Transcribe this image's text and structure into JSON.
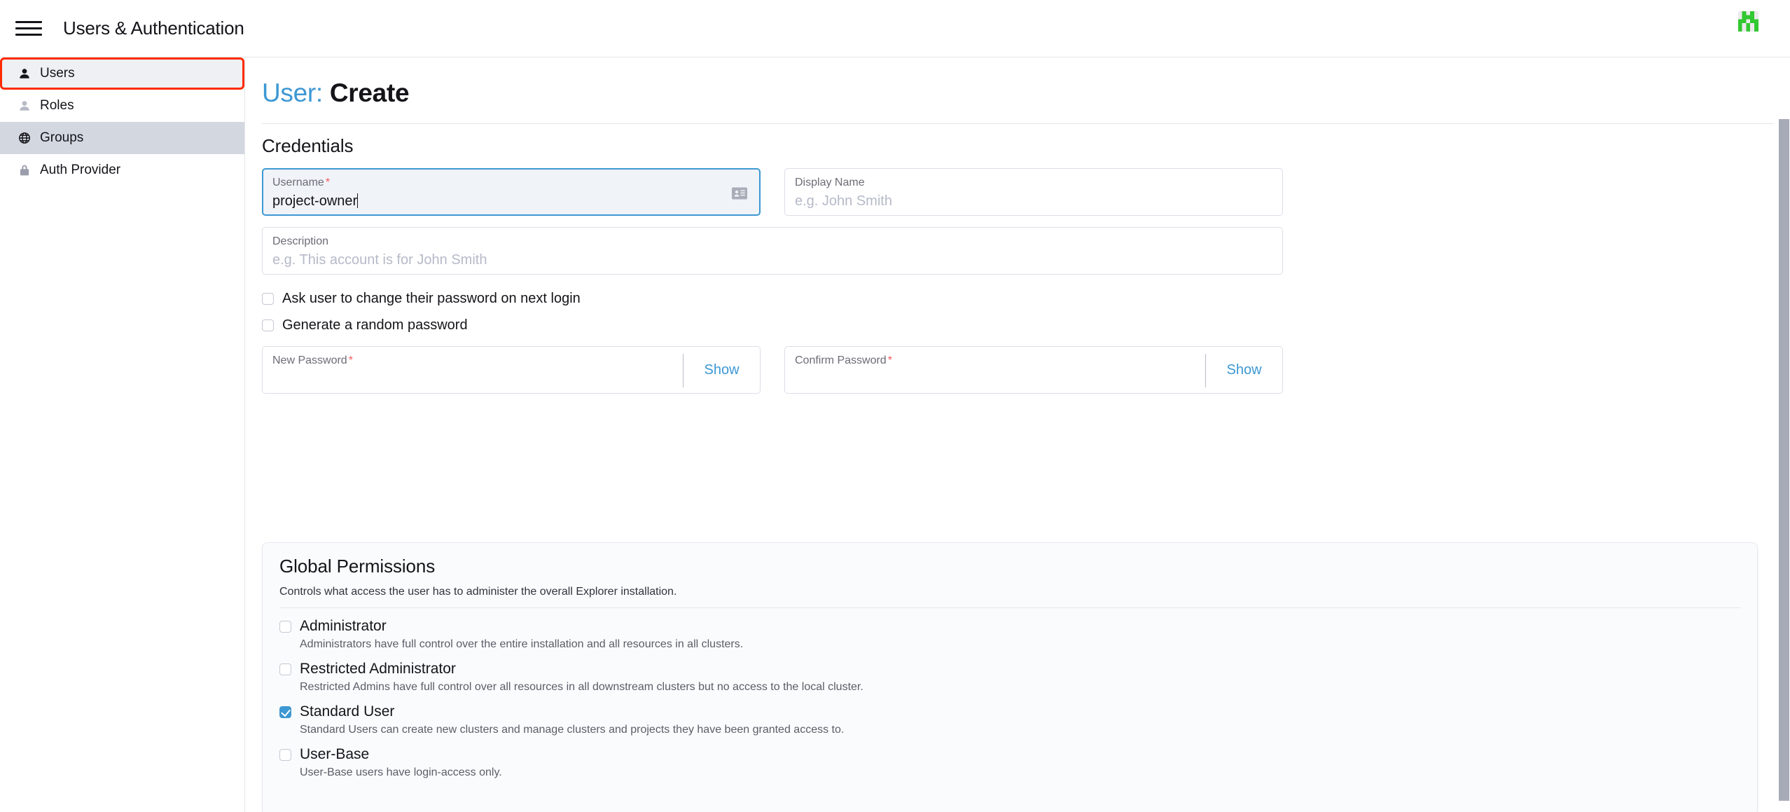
{
  "header": {
    "menu_icon": "hamburger-icon",
    "title": "Users & Authentication",
    "logo_icon": "rancher-logo",
    "logo_color": "#31c831"
  },
  "sidebar": {
    "items": [
      {
        "label": "Users",
        "icon": "user-icon",
        "state": "selected-outline"
      },
      {
        "label": "Roles",
        "icon": "user-outline-icon",
        "state": "default"
      },
      {
        "label": "Groups",
        "icon": "globe-icon",
        "state": "hovered"
      },
      {
        "label": "Auth Provider",
        "icon": "lock-icon",
        "state": "default"
      }
    ],
    "selection_outline_color": "#ff2b00"
  },
  "main": {
    "title_prefix": "User:",
    "title_text": "Create",
    "title_accent_color": "#3d98d3",
    "credentials": {
      "heading": "Credentials",
      "username": {
        "label": "Username",
        "required": "*",
        "value": "project-owner",
        "placeholder": "",
        "icon": "contact-card-icon",
        "focused": true
      },
      "display_name": {
        "label": "Display Name",
        "required": "",
        "value": "",
        "placeholder": "e.g. John Smith",
        "focused": false
      },
      "description": {
        "label": "Description",
        "required": "",
        "value": "",
        "placeholder": "e.g. This account is for John Smith",
        "focused": false
      },
      "checkboxes": [
        {
          "label": "Ask user to change their password on next login",
          "checked": false
        },
        {
          "label": "Generate a random password",
          "checked": false
        }
      ],
      "new_password": {
        "label": "New Password",
        "required": "*",
        "value": "",
        "show_label": "Show"
      },
      "confirm_password": {
        "label": "Confirm Password",
        "required": "*",
        "value": "",
        "show_label": "Show"
      }
    },
    "global_permissions": {
      "heading": "Global Permissions",
      "subtitle": "Controls what access the user has to administer the overall Explorer installation.",
      "items": [
        {
          "label": "Administrator",
          "description": "Administrators have full control over the entire installation and all resources in all clusters.",
          "checked": false
        },
        {
          "label": "Restricted Administrator",
          "description": "Restricted Admins have full control over all resources in all downstream clusters but no access to the local cluster.",
          "checked": false
        },
        {
          "label": "Standard User",
          "description": "Standard Users can create new clusters and manage clusters and projects they have been granted access to.",
          "checked": true
        },
        {
          "label": "User-Base",
          "description": "User-Base users have login-access only.",
          "checked": false
        }
      ]
    }
  },
  "scrollbar": {
    "thumb_color": "#a7abb8"
  }
}
